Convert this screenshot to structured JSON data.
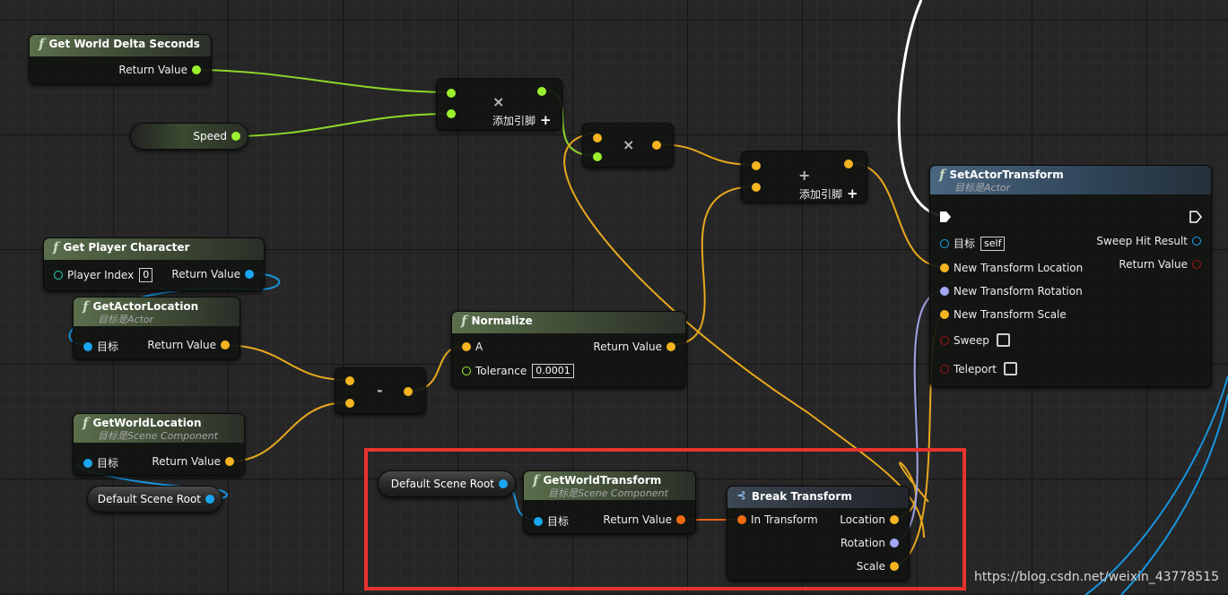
{
  "nodes": {
    "delta": {
      "title": "Get World Delta Seconds",
      "out": "Return Value"
    },
    "speed": {
      "label": "Speed"
    },
    "mul1": {
      "add_pin": "添加引脚"
    },
    "add": {
      "add_pin": "添加引脚"
    },
    "player": {
      "title": "Get Player Character",
      "in": "Player Index",
      "in_value": "0",
      "out": "Return Value"
    },
    "actorloc": {
      "title": "GetActorLocation",
      "subtitle_prefix": "目标是",
      "subtitle_class": "Actor",
      "in": "目标",
      "out": "Return Value"
    },
    "worldloc": {
      "title": "GetWorldLocation",
      "subtitle_prefix": "目标是",
      "subtitle_class": "Scene Component",
      "in": "目标",
      "out": "Return Value"
    },
    "scene_root_left": {
      "label": "Default Scene Root"
    },
    "scene_root_right": {
      "label": "Default Scene Root"
    },
    "normalize": {
      "title": "Normalize",
      "in_a": "A",
      "in_tol": "Tolerance",
      "tol_value": "0.0001",
      "out": "Return Value"
    },
    "worldtransform": {
      "title": "GetWorldTransform",
      "subtitle_prefix": "目标是",
      "subtitle_class": "Scene Component",
      "in": "目标",
      "out": "Return Value"
    },
    "breaktransform": {
      "title": "Break Transform",
      "in": "In Transform",
      "out_location": "Location",
      "out_rotation": "Rotation",
      "out_scale": "Scale"
    },
    "setactor": {
      "title": "SetActorTransform",
      "subtitle_prefix": "目标是",
      "subtitle_class": "Actor",
      "in_target": "目标",
      "target_value": "self",
      "in_location": "New Transform Location",
      "in_rotation": "New Transform Rotation",
      "in_scale": "New Transform Scale",
      "in_sweep": "Sweep",
      "in_teleport": "Teleport",
      "out_hit": "Sweep Hit Result",
      "out_return": "Return Value"
    }
  },
  "watermark": "https://blog.csdn.net/weixin_43778515",
  "colors": {
    "float_pin": "#9cf02e",
    "vector_pin": "#f5b420",
    "object_pin": "#1aa6f0",
    "transform_pin": "#f26a10",
    "rotator_pin": "#a2a8f5",
    "selection": "#e8322e"
  }
}
